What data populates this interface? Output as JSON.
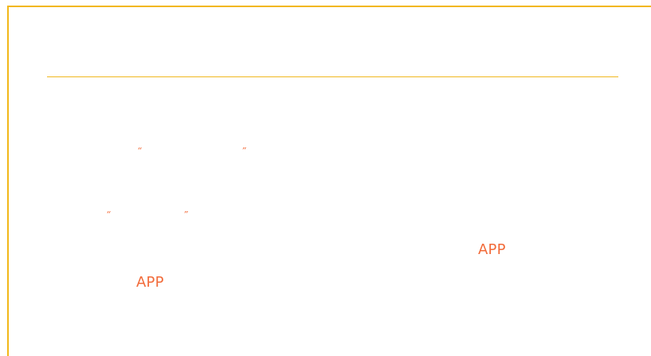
{
  "content": {
    "quote_open": "“",
    "quote_close": "”",
    "app_label": "APP"
  },
  "colors": {
    "border": "#f2b718",
    "divider": "#f0b81f",
    "accent_text": "#f26b3a"
  }
}
